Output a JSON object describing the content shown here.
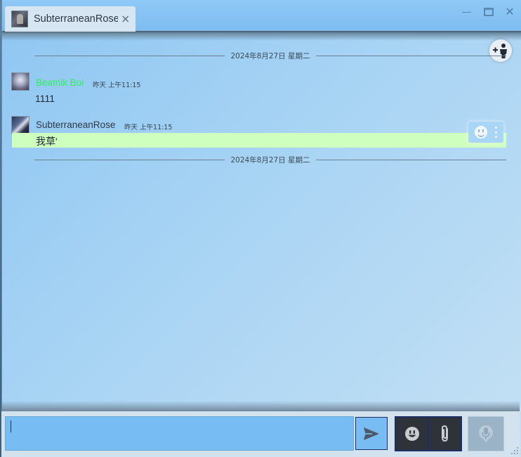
{
  "window": {
    "tab_title": "SubterraneanRose",
    "tab_close": "×",
    "close_glyph": "✕"
  },
  "chat": {
    "date_separators": [
      "2024年8月27日 星期二",
      "2024年8月27日 星期二"
    ],
    "messages": [
      {
        "sender": "Beatnik Boi",
        "time": "昨天 上午11:15",
        "text": "1111",
        "name_color": "#2df060"
      },
      {
        "sender": "SubterraneanRose",
        "time": "昨天 上午11:15",
        "text": "我草'",
        "highlight_color": "#cfffbf"
      }
    ]
  },
  "composer": {
    "input_value": ""
  },
  "icons": {
    "add_person": "add-person-icon",
    "send": "send-icon",
    "emoji": "emoji-icon",
    "attach": "paperclip-icon",
    "voice": "microphone-icon",
    "more": "more-vertical-icon"
  },
  "colors": {
    "accent": "#77bdf4",
    "tool_border": "#1d2d66"
  }
}
